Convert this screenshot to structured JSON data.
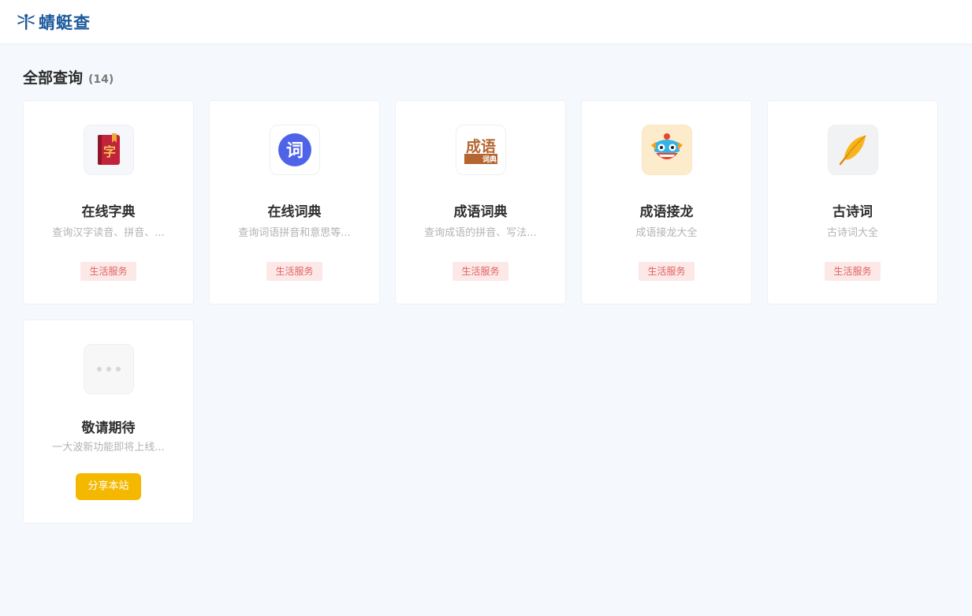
{
  "header": {
    "logo_text": "蜻蜓查",
    "logo_icon": "dragonfly-icon",
    "brand_color": "#1d5a9c"
  },
  "section": {
    "title": "全部查询",
    "count": "(14)"
  },
  "cards": [
    {
      "name": "在线字典",
      "desc": "查询汉字读音、拼音、...",
      "tag": "生活服务",
      "icon": "red-book-zi-icon"
    },
    {
      "name": "在线词典",
      "desc": "查询词语拼音和意思等...",
      "tag": "生活服务",
      "icon": "blue-circle-ci-icon"
    },
    {
      "name": "成语词典",
      "desc": "查询成语的拼音、写法...",
      "tag": "生活服务",
      "icon": "chengyu-cidian-icon"
    },
    {
      "name": "成语接龙",
      "desc": "成语接龙大全",
      "tag": "生活服务",
      "icon": "lion-dance-icon"
    },
    {
      "name": "古诗词",
      "desc": "古诗词大全",
      "tag": "生活服务",
      "icon": "feather-quill-icon"
    },
    {
      "name": "敬请期待",
      "desc": "一大波新功能即将上线...",
      "button": "分享本站",
      "icon": "ellipsis-icon"
    }
  ],
  "colors": {
    "tag_bg": "#fde8e8",
    "tag_text": "#e0635f",
    "share_button": "#f5b800",
    "page_bg": "#f5f8fc"
  }
}
